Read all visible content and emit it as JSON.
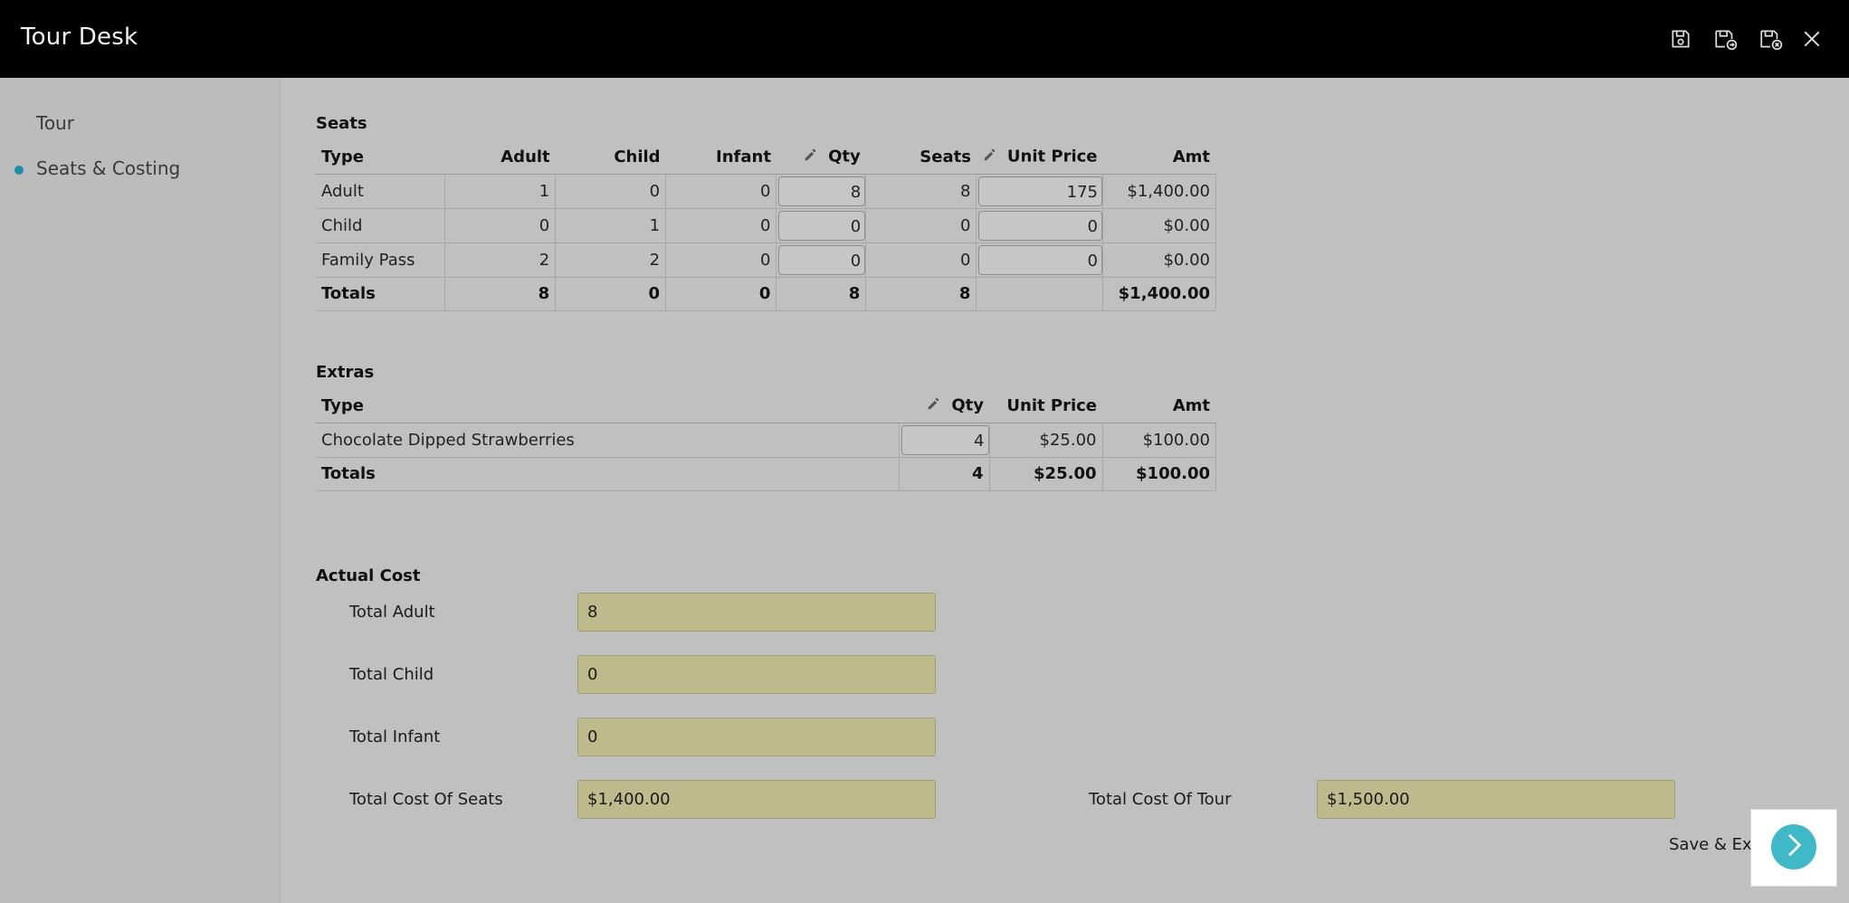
{
  "app": {
    "title": "Tour Desk"
  },
  "toolbar": {
    "icons": [
      "save-icon",
      "save-new-icon",
      "save-close-icon",
      "close-icon"
    ]
  },
  "sidebar": {
    "items": [
      {
        "label": "Tour",
        "active": false
      },
      {
        "label": "Seats & Costing",
        "active": true
      }
    ]
  },
  "seats": {
    "title": "Seats",
    "columns": [
      "Type",
      "Adult",
      "Child",
      "Infant",
      "Qty",
      "Seats",
      "Unit Price",
      "Amt"
    ],
    "rows": [
      {
        "type": "Adult",
        "adult": "1",
        "child": "0",
        "infant": "0",
        "qty": "8",
        "seats": "8",
        "unit_price": "175",
        "amt": "$1,400.00"
      },
      {
        "type": "Child",
        "adult": "0",
        "child": "1",
        "infant": "0",
        "qty": "0",
        "seats": "0",
        "unit_price": "0",
        "amt": "$0.00"
      },
      {
        "type": "Family Pass",
        "adult": "2",
        "child": "2",
        "infant": "0",
        "qty": "0",
        "seats": "0",
        "unit_price": "0",
        "amt": "$0.00"
      }
    ],
    "totals": {
      "label": "Totals",
      "adult": "8",
      "child": "0",
      "infant": "0",
      "qty": "8",
      "seats": "8",
      "unit_price": "",
      "amt": "$1,400.00"
    }
  },
  "extras": {
    "title": "Extras",
    "columns": [
      "Type",
      "Qty",
      "Unit Price",
      "Amt"
    ],
    "rows": [
      {
        "type": "Chocolate Dipped Strawberries",
        "qty": "4",
        "unit_price": "$25.00",
        "amt": "$100.00"
      }
    ],
    "totals": {
      "label": "Totals",
      "qty": "4",
      "unit_price": "$25.00",
      "amt": "$100.00"
    }
  },
  "actual_cost": {
    "title": "Actual Cost",
    "total_adult": {
      "label": "Total Adult",
      "value": "8"
    },
    "total_child": {
      "label": "Total Child",
      "value": "0"
    },
    "total_infant": {
      "label": "Total Infant",
      "value": "0"
    },
    "total_cost_seats": {
      "label": "Total Cost Of Seats",
      "value": "$1,400.00"
    },
    "total_cost_tour": {
      "label": "Total Cost Of Tour",
      "value": "$1,500.00"
    }
  },
  "footer": {
    "save_exit_label": "Save & Exit"
  },
  "colors": {
    "accent": "#3fb9c8",
    "field_bg": "#bdbb8c",
    "topbar": "#000000",
    "active_dot": "#1f8fa8"
  }
}
